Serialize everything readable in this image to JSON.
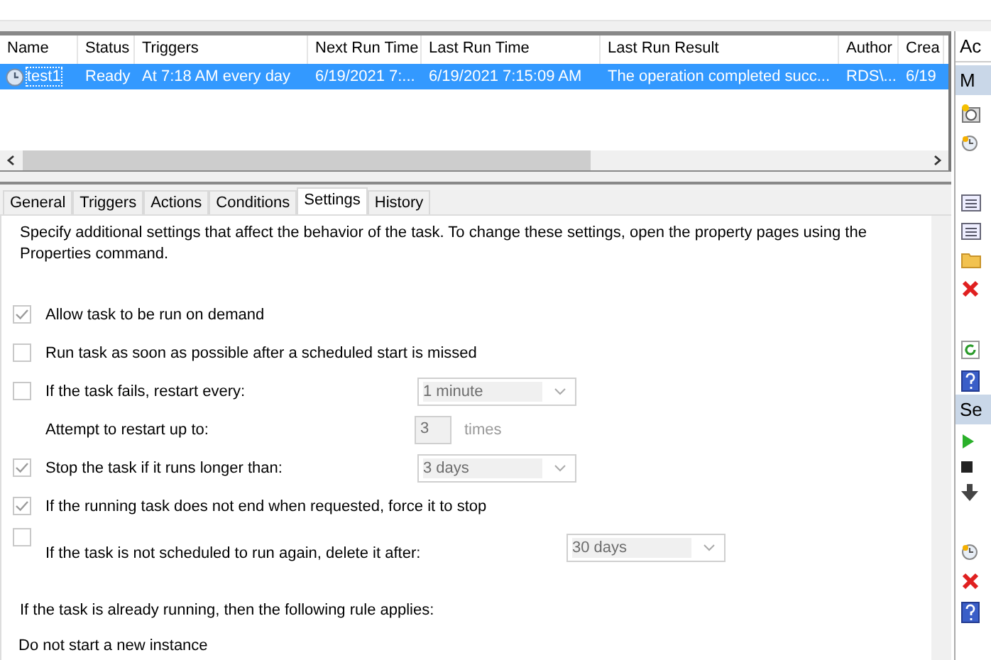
{
  "table": {
    "columns": [
      "Name",
      "Status",
      "Triggers",
      "Next Run Time",
      "Last Run Time",
      "Last Run Result",
      "Author",
      "Crea"
    ],
    "rows": [
      {
        "selected": true,
        "cells": [
          "test1",
          "Ready",
          "At 7:18 AM every day",
          "6/19/2021 7:...",
          "6/19/2021 7:15:09 AM",
          "The operation completed succ...",
          "RDS\\...",
          "6/19"
        ]
      }
    ]
  },
  "tabs": [
    {
      "label": "General",
      "selected": false
    },
    {
      "label": "Triggers",
      "selected": false
    },
    {
      "label": "Actions",
      "selected": false
    },
    {
      "label": "Conditions",
      "selected": false
    },
    {
      "label": "Settings",
      "selected": true
    },
    {
      "label": "History",
      "selected": false
    }
  ],
  "settings": {
    "intro": "Specify additional settings that affect the behavior of the task. To change these settings, open the property pages using the Properties command.",
    "options": [
      {
        "kind": "option",
        "label": "Allow task to be run on demand",
        "checked": true
      },
      {
        "kind": "option",
        "label": "Run task as soon as possible after a scheduled start is missed",
        "checked": false
      },
      {
        "kind": "option",
        "label": "If the task fails, restart every:",
        "checked": false,
        "dropdown": "1 minute"
      },
      {
        "kind": "count",
        "label": "Attempt to restart up to:",
        "value": "3",
        "unit": "times"
      },
      {
        "kind": "option",
        "label": "Stop the task if it runs longer than:",
        "checked": true,
        "dropdown": "3 days"
      },
      {
        "kind": "option",
        "label": "If the running task does not end when requested, force it to stop",
        "checked": true
      },
      {
        "kind": "expiry",
        "label": "If the task is not scheduled to run again, delete it after:",
        "checked": false,
        "dropdown": "30 days"
      }
    ],
    "rule_label": "If the task is already running, then the following rule applies:",
    "rule_value": "Do not start a new instance"
  },
  "actions_pane": {
    "title": "Ac",
    "sections": [
      {
        "title": "M"
      },
      {
        "title": "Se"
      }
    ]
  }
}
